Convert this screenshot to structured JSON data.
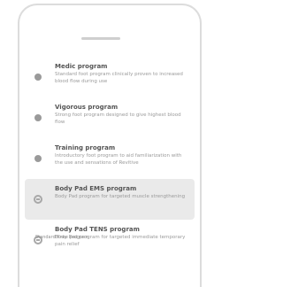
{
  "programs": [
    {
      "title": "Medic program",
      "description": "Standard foot program clinically proven to increased blood flow during use",
      "icon": "dot-icon"
    },
    {
      "title": "Vigorous program",
      "description": "Strong foot program designed to give highest blood flow",
      "icon": "dot-icon"
    },
    {
      "title": "Training program",
      "description": "Introductory foot program to aid familiarization with the use and sensations of Revitive",
      "icon": "dot-icon"
    },
    {
      "title": "Body Pad EMS program",
      "description": "Body Pad program for targeted muscle strengthening",
      "icon": "body-pad-icon"
    },
    {
      "title": "Body Pad TENS program",
      "description": "Body Pad program for targeted immediate temporary pain relief",
      "icon": "body-pad-icon"
    }
  ],
  "footer_partial": "Standard Knee program"
}
